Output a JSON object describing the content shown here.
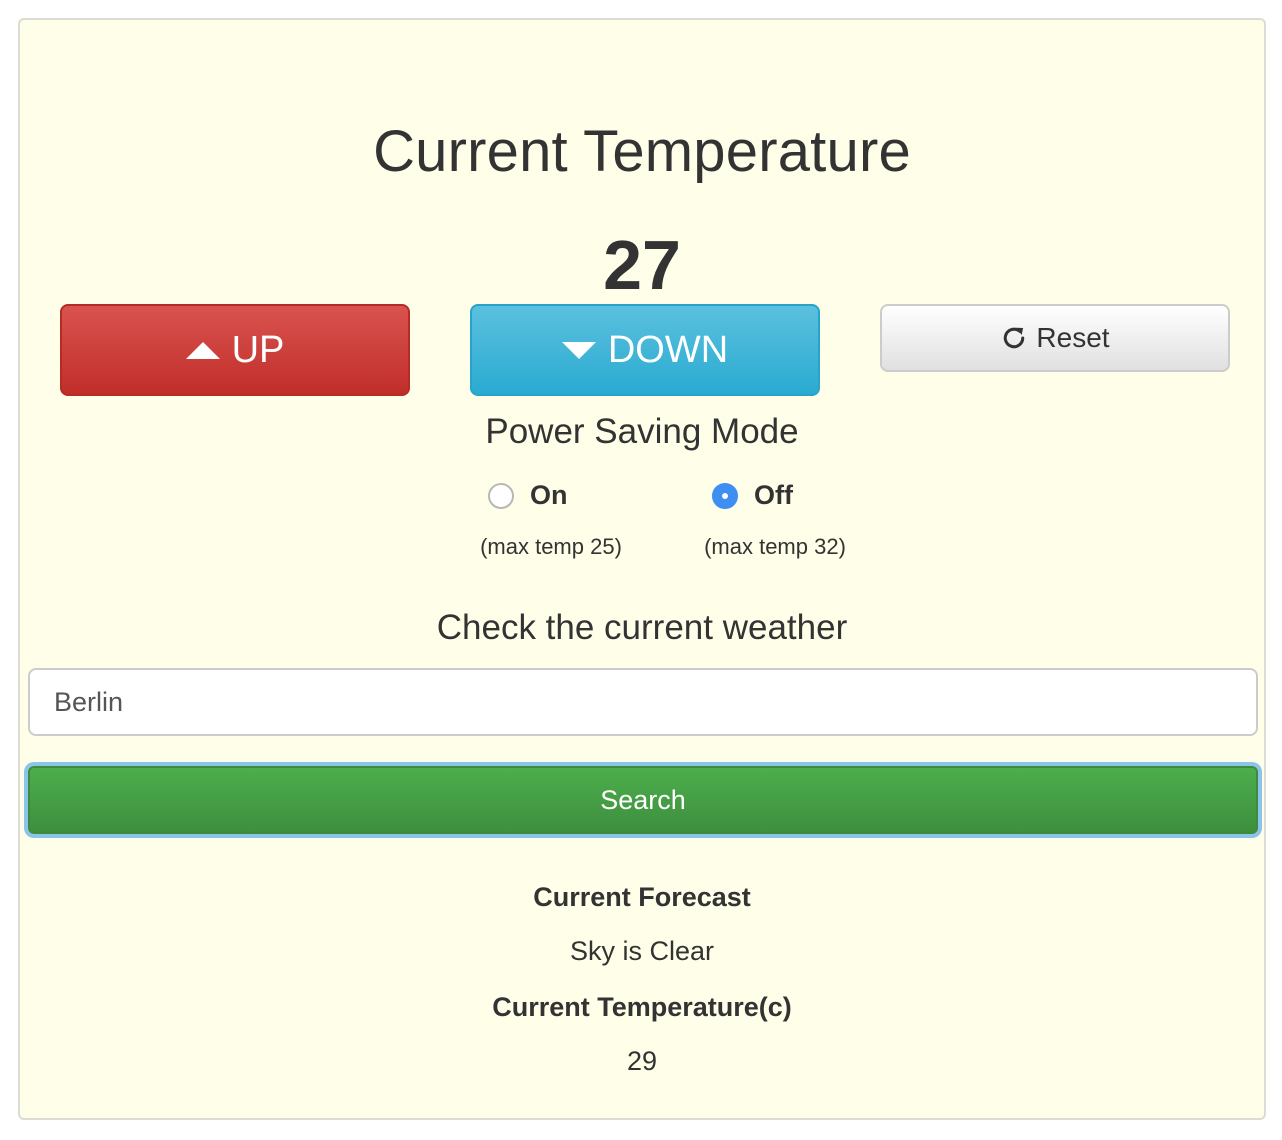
{
  "thermostat": {
    "title": "Current Temperature",
    "temperature": "27",
    "up_label": "UP",
    "down_label": "DOWN",
    "reset_label": "Reset"
  },
  "power_saving": {
    "heading": "Power Saving Mode",
    "options": [
      {
        "label": "On",
        "note": "(max temp 25)",
        "selected": false
      },
      {
        "label": "Off",
        "note": "(max temp 32)",
        "selected": true
      }
    ]
  },
  "weather": {
    "heading": "Check the current weather",
    "city_value": "Berlin",
    "search_label": "Search",
    "forecast_heading": "Current Forecast",
    "forecast_value": "Sky is Clear",
    "temp_heading": "Current Temperature(c)",
    "temp_value": "29"
  },
  "colors": {
    "panel_bg": "#fefee9",
    "up_button": "#d9534f",
    "down_button": "#5bc0de",
    "search_button": "#449d44",
    "radio_selected": "#3f8ef3"
  },
  "icons": {
    "up": "triangle-up-icon",
    "down": "triangle-down-icon",
    "reset": "refresh-icon"
  }
}
